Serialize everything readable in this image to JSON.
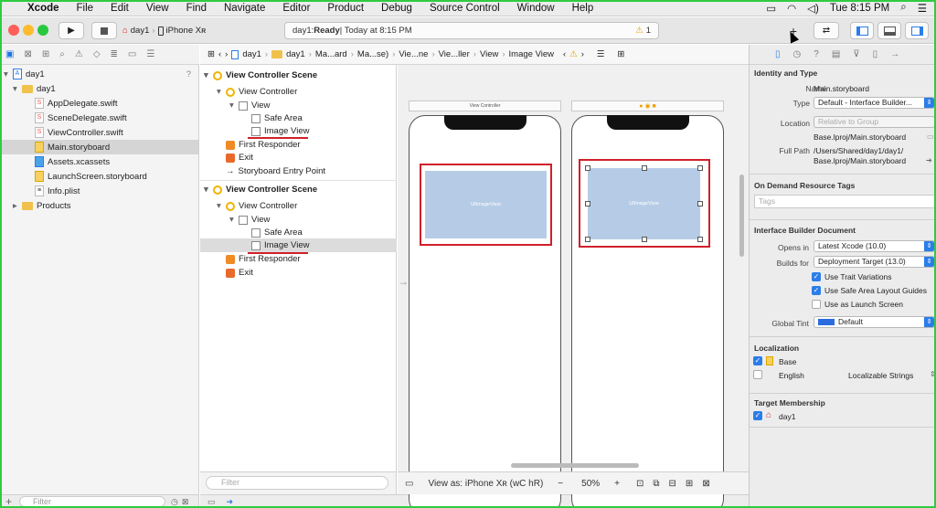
{
  "menubar": {
    "app": "Xcode",
    "items": [
      "File",
      "Edit",
      "View",
      "Find",
      "Navigate",
      "Editor",
      "Product",
      "Debug",
      "Source Control",
      "Window",
      "Help"
    ],
    "clock": "Tue 8:15 PM"
  },
  "toolbar": {
    "scheme": "day1",
    "device": "iPhone Xʀ",
    "status_prefix": "day1: ",
    "status_bold": "Ready",
    "status_suffix": " | Today at 8:15 PM",
    "warning_count": "1"
  },
  "navigator": {
    "items": [
      {
        "label": "day1",
        "indent": 0,
        "kind": "project",
        "badge": "?"
      },
      {
        "label": "day1",
        "indent": 1,
        "kind": "folder"
      },
      {
        "label": "AppDelegate.swift",
        "indent": 2,
        "kind": "swift"
      },
      {
        "label": "SceneDelegate.swift",
        "indent": 2,
        "kind": "swift"
      },
      {
        "label": "ViewController.swift",
        "indent": 2,
        "kind": "swift"
      },
      {
        "label": "Main.storyboard",
        "indent": 2,
        "kind": "storyboard",
        "selected": true
      },
      {
        "label": "Assets.xcassets",
        "indent": 2,
        "kind": "assets"
      },
      {
        "label": "LaunchScreen.storyboard",
        "indent": 2,
        "kind": "storyboard"
      },
      {
        "label": "Info.plist",
        "indent": 2,
        "kind": "plist"
      },
      {
        "label": "Products",
        "indent": 1,
        "kind": "folder"
      }
    ],
    "filter_placeholder": "Filter"
  },
  "jumpbar": [
    "day1",
    "day1",
    "Ma...ard",
    "Ma...se)",
    "Vie...ne",
    "Vie...ller",
    "View",
    "Image View"
  ],
  "outline": {
    "rows": [
      {
        "label": "View Controller Scene",
        "indent": 0,
        "kind": "scene",
        "header": true
      },
      {
        "label": "View Controller",
        "indent": 1,
        "kind": "vc"
      },
      {
        "label": "View",
        "indent": 2,
        "kind": "view"
      },
      {
        "label": "Safe Area",
        "indent": 3,
        "kind": "view"
      },
      {
        "label": "Image View",
        "indent": 3,
        "kind": "image",
        "underlined": true
      },
      {
        "label": "First Responder",
        "indent": 1,
        "kind": "responder"
      },
      {
        "label": "Exit",
        "indent": 1,
        "kind": "exit"
      },
      {
        "label": "Storyboard Entry Point",
        "indent": 1,
        "kind": "arrow"
      },
      {
        "label": "View Controller Scene",
        "indent": 0,
        "kind": "scene",
        "header": true
      },
      {
        "label": "View Controller",
        "indent": 1,
        "kind": "vc"
      },
      {
        "label": "View",
        "indent": 2,
        "kind": "view"
      },
      {
        "label": "Safe Area",
        "indent": 3,
        "kind": "view"
      },
      {
        "label": "Image View",
        "indent": 3,
        "kind": "image",
        "selected": true,
        "underlined": true
      },
      {
        "label": "First Responder",
        "indent": 1,
        "kind": "responder"
      },
      {
        "label": "Exit",
        "indent": 1,
        "kind": "exit"
      }
    ],
    "filter_placeholder": "Filter"
  },
  "canvas": {
    "scene1_title": "View Controller",
    "image_view_label": "UIImageView",
    "view_as": "View as: iPhone Xʀ (wC hR)",
    "zoom": "50%"
  },
  "inspector": {
    "identity_title": "Identity and Type",
    "name_label": "Name",
    "name_value": "Main.storyboard",
    "type_label": "Type",
    "type_value": "Default - Interface Builder...",
    "location_label": "Location",
    "location_value": "Relative to Group",
    "location_path": "Base.lproj/Main.storyboard",
    "fullpath_label": "Full Path",
    "fullpath_value1": "/Users/Shared/day1/day1/",
    "fullpath_value2": "Base.lproj/Main.storyboard",
    "odr_title": "On Demand Resource Tags",
    "tags_placeholder": "Tags",
    "ibd_title": "Interface Builder Document",
    "opens_label": "Opens in",
    "opens_value": "Latest Xcode (10.0)",
    "builds_label": "Builds for",
    "builds_value": "Deployment Target (13.0)",
    "chk_trait": "Use Trait Variations",
    "chk_safe": "Use Safe Area Layout Guides",
    "chk_launch": "Use as Launch Screen",
    "tint_label": "Global Tint",
    "tint_value": "Default",
    "loc_title": "Localization",
    "loc_base": "Base",
    "loc_english": "English",
    "loc_strings": "Localizable Strings",
    "tm_title": "Target Membership",
    "tm_target": "day1"
  },
  "colors": {
    "accent": "#2b7de9",
    "highlight": "#d0202a",
    "image_view": "#b6cce6",
    "frame": "#2ecc40"
  }
}
